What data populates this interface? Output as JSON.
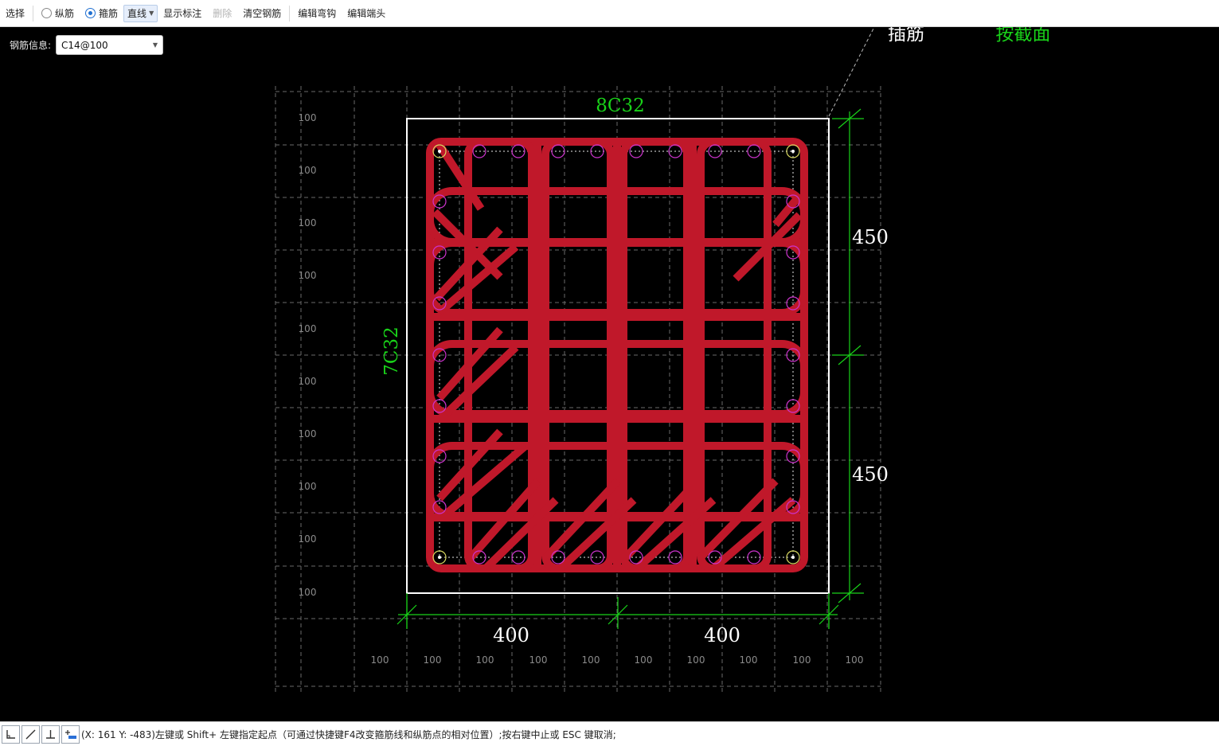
{
  "toolbar": {
    "select_label": "选择",
    "longitudinal_label": "纵筋",
    "stirrup_label": "箍筋",
    "line_mode_label": "直线",
    "show_annotation_label": "显示标注",
    "delete_label": "删除",
    "clear_rebar_label": "清空钢筋",
    "edit_hook_label": "编辑弯钩",
    "edit_end_label": "编辑端头",
    "selected_radio": "stirrup"
  },
  "rebar_info": {
    "label": "钢筋信息:",
    "value": "C14@100"
  },
  "drawing": {
    "top_rebar_label": "8C32",
    "side_rebar_label": "7C32",
    "corner_label_1": "插筋",
    "corner_label_2": "按截面",
    "dim_right_top": "450",
    "dim_right_bottom": "450",
    "dim_bottom_left": "400",
    "dim_bottom_right": "400",
    "grid_label": "100",
    "colors": {
      "stirrup": "#c0182a",
      "dimension": "#19d219",
      "section": "#ffffff",
      "grid": "#6a6a6a",
      "bar_middle": "#cc33cc",
      "bar_corner": "#d8d860"
    }
  },
  "statusbar": {
    "message": "(X: 161 Y: -483)左键或 Shift+ 左键指定起点（可通过快捷键F4改变箍筋线和纵筋点的相对位置）;按右键中止或 ESC 键取消;",
    "buttons": [
      "ortho-icon",
      "line-icon",
      "perpendicular-icon",
      "offset-icon"
    ]
  }
}
